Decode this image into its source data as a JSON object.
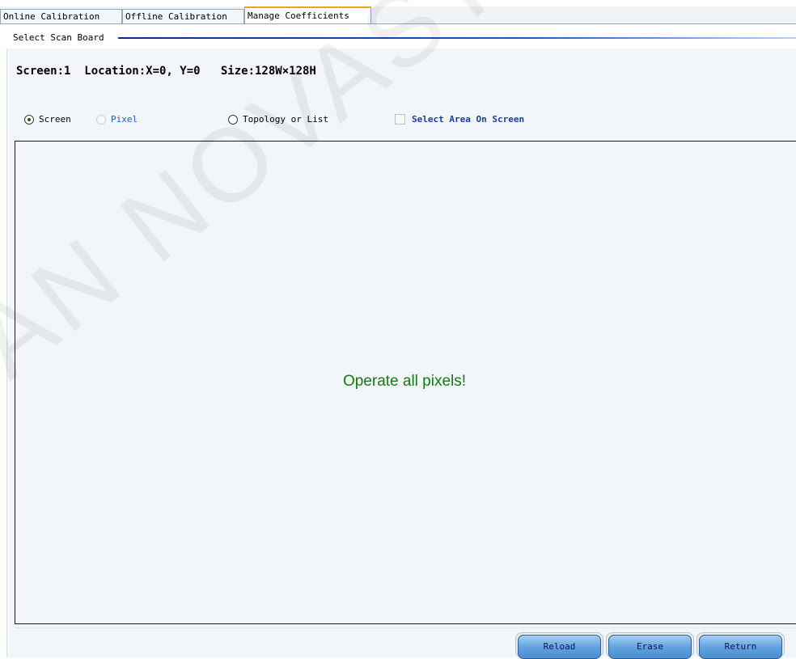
{
  "tabs": [
    {
      "label": "Online Calibration",
      "active": false
    },
    {
      "label": "Offline Calibration",
      "active": false
    },
    {
      "label": "Manage Coefficients",
      "active": true
    }
  ],
  "group": {
    "label": "Select Scan Board"
  },
  "screen_info": "Screen:1  Location:X=0, Y=0   Size:128W×128H",
  "options": {
    "screen": {
      "label": "Screen",
      "checked": true
    },
    "pixel": {
      "label": "Pixel",
      "enabled": false
    },
    "topology": {
      "label": "Topology or List",
      "checked": false
    },
    "select_area": {
      "label": "Select Area On Screen",
      "checked": false
    }
  },
  "canvas": {
    "message": "Operate all pixels!"
  },
  "buttons": {
    "reload": "Reload",
    "erase": "Erase",
    "return": "Return"
  },
  "watermark": "AN NOVASTAR TECH CO",
  "colors": {
    "accent_tab": "#f0a020",
    "message": "#0f7d0f",
    "button": "#5e9fdc",
    "panel_bg": "#f2f6fa"
  }
}
